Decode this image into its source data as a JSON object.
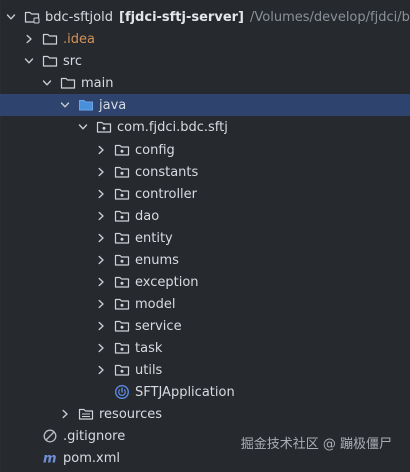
{
  "project_tree": {
    "root": {
      "name": "bdc-sftjold",
      "module": "[fjdci-sftj-server]",
      "path": "/Volumes/develop/fjdci/bdc-s"
    },
    "nodes": [
      {
        "label": ".idea"
      },
      {
        "label": "src"
      },
      {
        "label": "main"
      },
      {
        "label": "java"
      },
      {
        "label": "com.fjdci.bdc.sftj"
      },
      {
        "label": "config"
      },
      {
        "label": "constants"
      },
      {
        "label": "controller"
      },
      {
        "label": "dao"
      },
      {
        "label": "entity"
      },
      {
        "label": "enums"
      },
      {
        "label": "exception"
      },
      {
        "label": "model"
      },
      {
        "label": "service"
      },
      {
        "label": "task"
      },
      {
        "label": "utils"
      },
      {
        "label": "SFTJApplication"
      },
      {
        "label": "resources"
      },
      {
        "label": ".gitignore"
      },
      {
        "label": "pom.xml"
      }
    ]
  },
  "selected_node": "java",
  "watermark": "掘金技术社区 @ 蹦极僵尸",
  "colors": {
    "background": "#262a2f",
    "selection": "#2e436e",
    "excluded_folder": "#d2915a",
    "source_root_folder": "#4a8fd9",
    "spring_class": "#5b8ae0"
  },
  "icons": {
    "expanded": "chevron-down-icon",
    "collapsed": "chevron-right-icon",
    "folder": "folder-icon",
    "source_folder": "source-folder-icon",
    "package": "package-icon",
    "resources_folder": "resources-folder-icon",
    "spring_class": "spring-boot-class-icon",
    "ignore_file": "gitignore-icon",
    "maven_file": "maven-icon"
  }
}
